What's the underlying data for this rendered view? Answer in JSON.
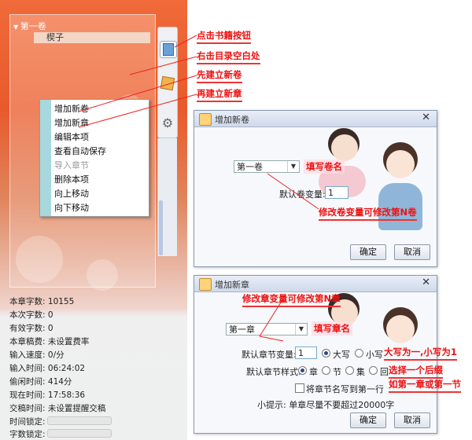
{
  "tree": {
    "volume": "第一卷",
    "chapter": "楔子"
  },
  "context_menu": {
    "items": [
      {
        "label": "增加新卷",
        "disabled": false
      },
      {
        "label": "增加新章",
        "disabled": false
      },
      {
        "label": "编辑本项",
        "disabled": false
      },
      {
        "label": "查看自动保存",
        "disabled": false
      },
      {
        "label": "导入章节",
        "disabled": true
      },
      {
        "label": "删除本项",
        "disabled": false
      },
      {
        "label": "向上移动",
        "disabled": false
      },
      {
        "label": "向下移动",
        "disabled": false
      }
    ]
  },
  "stats": [
    {
      "label": "本章字数:",
      "value": "10155"
    },
    {
      "label": "本次字数:",
      "value": "0"
    },
    {
      "label": "有效字数:",
      "value": "0"
    },
    {
      "label": "本章稿费:",
      "value": "未设置费率"
    },
    {
      "label": "输入速度:",
      "value": "0/分"
    },
    {
      "label": "输入时间:",
      "value": "06:24:02"
    },
    {
      "label": "偷闲时间:",
      "value": "414分"
    },
    {
      "label": "现在时间:",
      "value": "17:58:36"
    },
    {
      "label": "交稿时间:",
      "value": "未设置提醒交稿"
    },
    {
      "label": "时间锁定:",
      "value": ""
    },
    {
      "label": "字数锁定:",
      "value": ""
    }
  ],
  "annotations": {
    "click_book": "点击书籍按钮",
    "right_click": "右击目录空白处",
    "new_volume_first": "先建立新卷",
    "new_chapter_then": "再建立新章",
    "fill_volume": "填写卷名",
    "volume_var_tip": "修改卷变量可修改第N卷",
    "chapter_var_tip": "修改章变量可修改第N章",
    "fill_chapter": "填写章名",
    "case_tip": "大写为一,小写为1",
    "suffix_tip": "选择一个后缀",
    "suffix_example": "如第一章或第一节"
  },
  "dialog_volume": {
    "title": "增加新卷",
    "combo_value": "第一卷",
    "var_label": "默认卷变量:",
    "var_value": "1",
    "ok": "确定",
    "cancel": "取消",
    "close": "✕"
  },
  "dialog_chapter": {
    "title": "增加新章",
    "combo_value": "第一章",
    "var_label": "默认章节变量:",
    "var_value": "1",
    "upper": "大写",
    "lower": "小写",
    "style_label": "默认章节样式:",
    "styles": [
      "章",
      "节",
      "集",
      "回"
    ],
    "write_first_line": "将章节名写到第一行",
    "tip": "小提示: 单章尽量不要超过20000字",
    "ok": "确定",
    "cancel": "取消",
    "close": "✕"
  }
}
